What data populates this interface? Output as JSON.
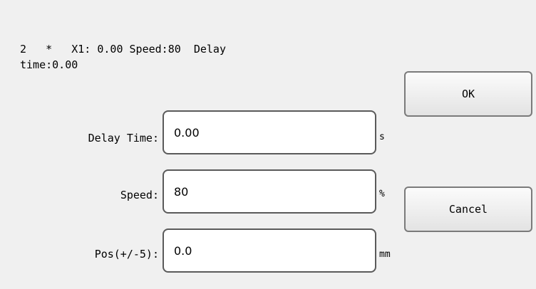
{
  "info": {
    "text": "2   *   X1: 0.00 Speed:80  Delay\ntime:0.00"
  },
  "fields": [
    {
      "label": "Delay Time:",
      "value": "0.00",
      "unit": "s"
    },
    {
      "label": "Speed:",
      "value": "80",
      "unit": "%"
    },
    {
      "label": "Pos(+/-5):",
      "value": "0.0",
      "unit": "mm"
    }
  ],
  "buttons": {
    "ok": "OK",
    "cancel": "Cancel"
  }
}
